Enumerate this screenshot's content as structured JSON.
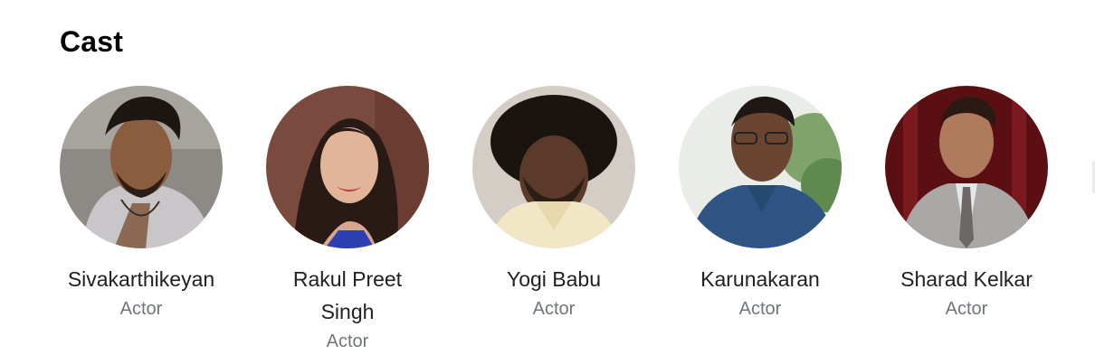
{
  "section": {
    "title": "Cast"
  },
  "cast": [
    {
      "name": "Sivakarthikeyan",
      "role": "Actor"
    },
    {
      "name": "Rakul Preet Singh",
      "role": "Actor"
    },
    {
      "name": "Yogi Babu",
      "role": "Actor"
    },
    {
      "name": "Karunakaran",
      "role": "Actor"
    },
    {
      "name": "Sharad Kelkar",
      "role": "Actor"
    }
  ],
  "colors": {
    "name_text": "#202124",
    "role_text": "#70757a",
    "title_text": "#000000"
  }
}
